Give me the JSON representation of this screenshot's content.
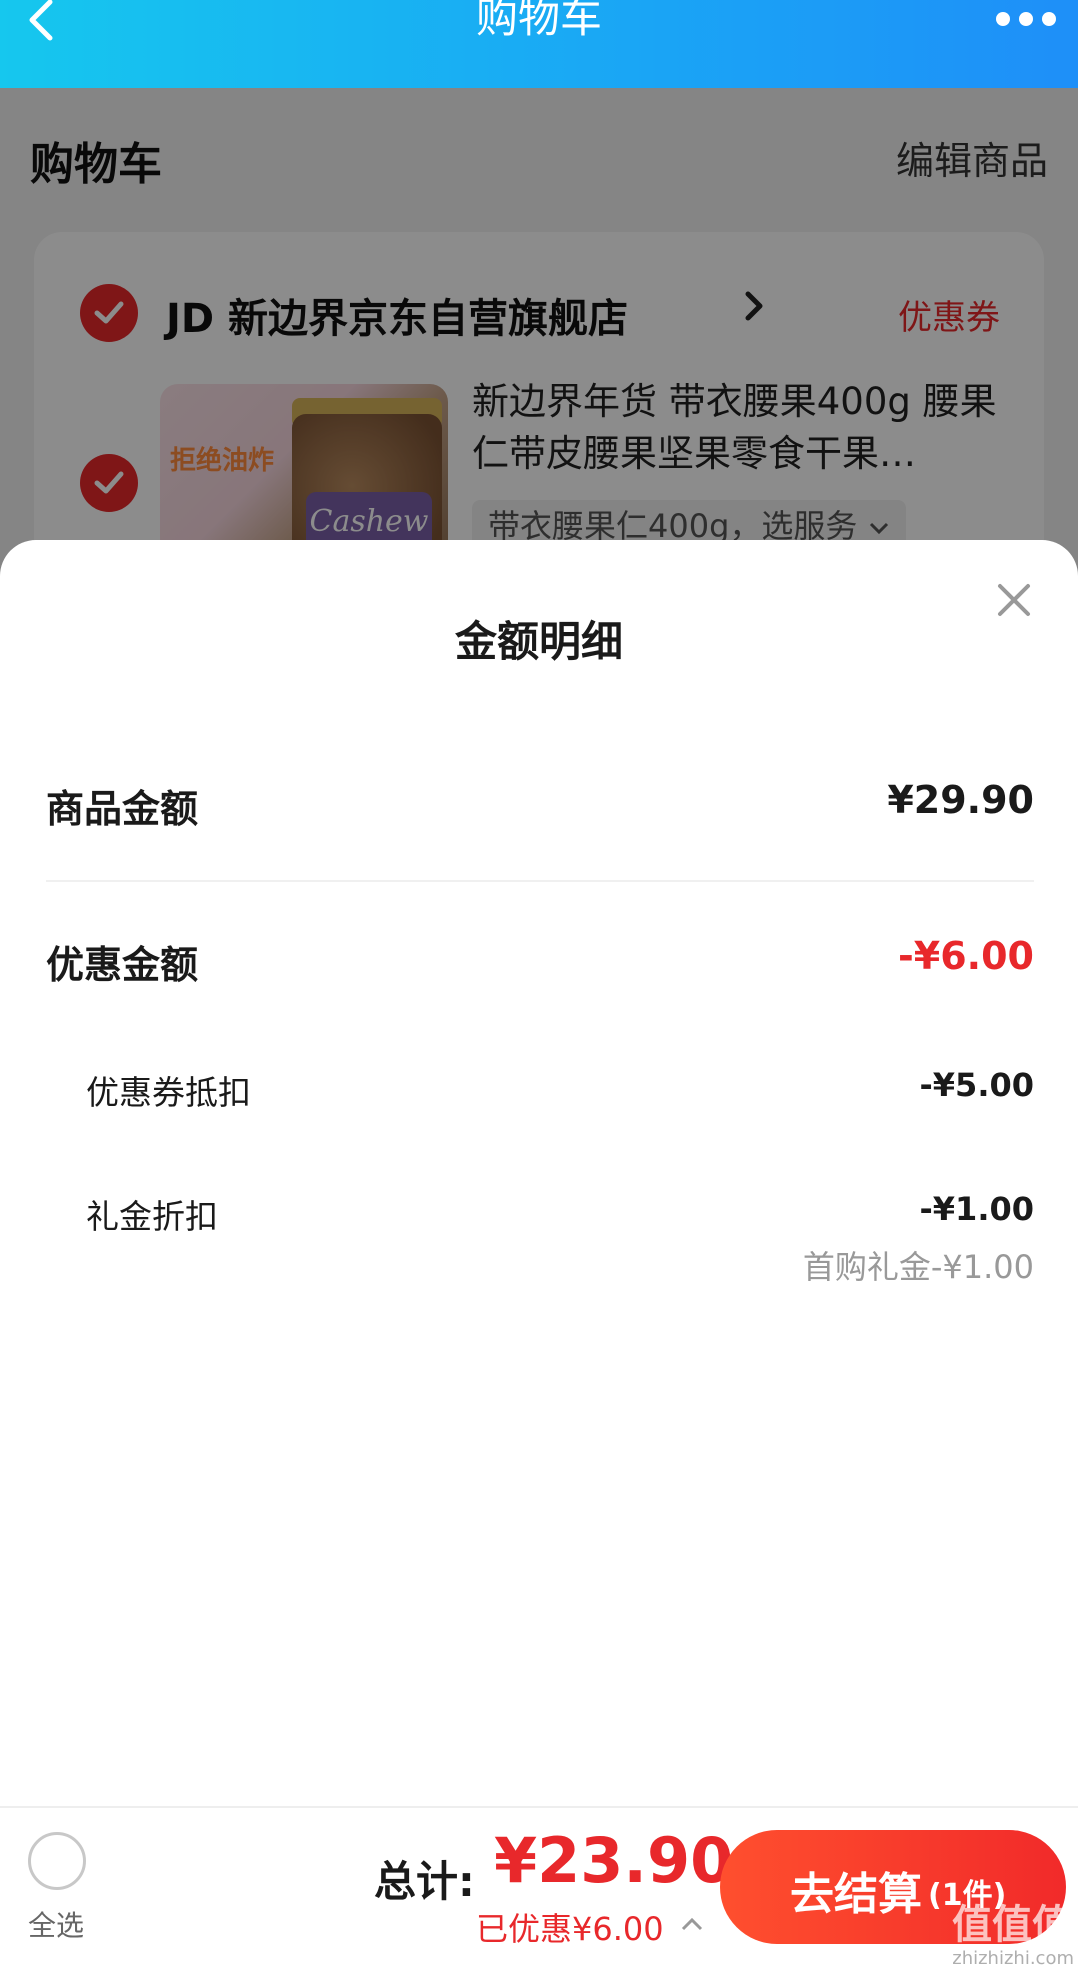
{
  "nav": {
    "title": "购物车"
  },
  "cart": {
    "heading": "购物车",
    "edit_label": "编辑商品",
    "store": {
      "name": "JD 新边界京东自营旗舰店",
      "coupon_label": "优惠券"
    },
    "product": {
      "title": "新边界年货 带衣腰果400g 腰果仁带皮腰果坚果零食干果…",
      "spec": "带衣腰果仁400g，选服务",
      "image_text": "拒绝油炸",
      "image_label": "Cashew"
    }
  },
  "sheet": {
    "title": "金额明细",
    "rows": [
      {
        "label": "商品金额",
        "value": "¥29.90"
      },
      {
        "label": "优惠金额",
        "value": "-¥6.00"
      },
      {
        "label": "优惠券抵扣",
        "value": "-¥5.00"
      },
      {
        "label": "礼金折扣",
        "value": "-¥1.00",
        "note": "首购礼金-¥1.00"
      }
    ]
  },
  "bottom": {
    "select_all": "全选",
    "total_label": "总计:",
    "total_value": "¥23.90",
    "saved": "已优惠¥6.00",
    "checkout_label": "去结算",
    "checkout_count": "(1件)"
  },
  "watermark": {
    "logo": "值值值",
    "domain": "zhizhizhi.com"
  },
  "colors": {
    "accent": "#e8282b",
    "nav_gradient_start": "#16c7ee",
    "nav_gradient_end": "#1e8ff8"
  },
  "icons": [
    "back-arrow-icon",
    "more-dots-icon",
    "check-icon",
    "chevron-right-icon",
    "close-icon",
    "chevron-up-icon",
    "chevron-down-icon"
  ]
}
